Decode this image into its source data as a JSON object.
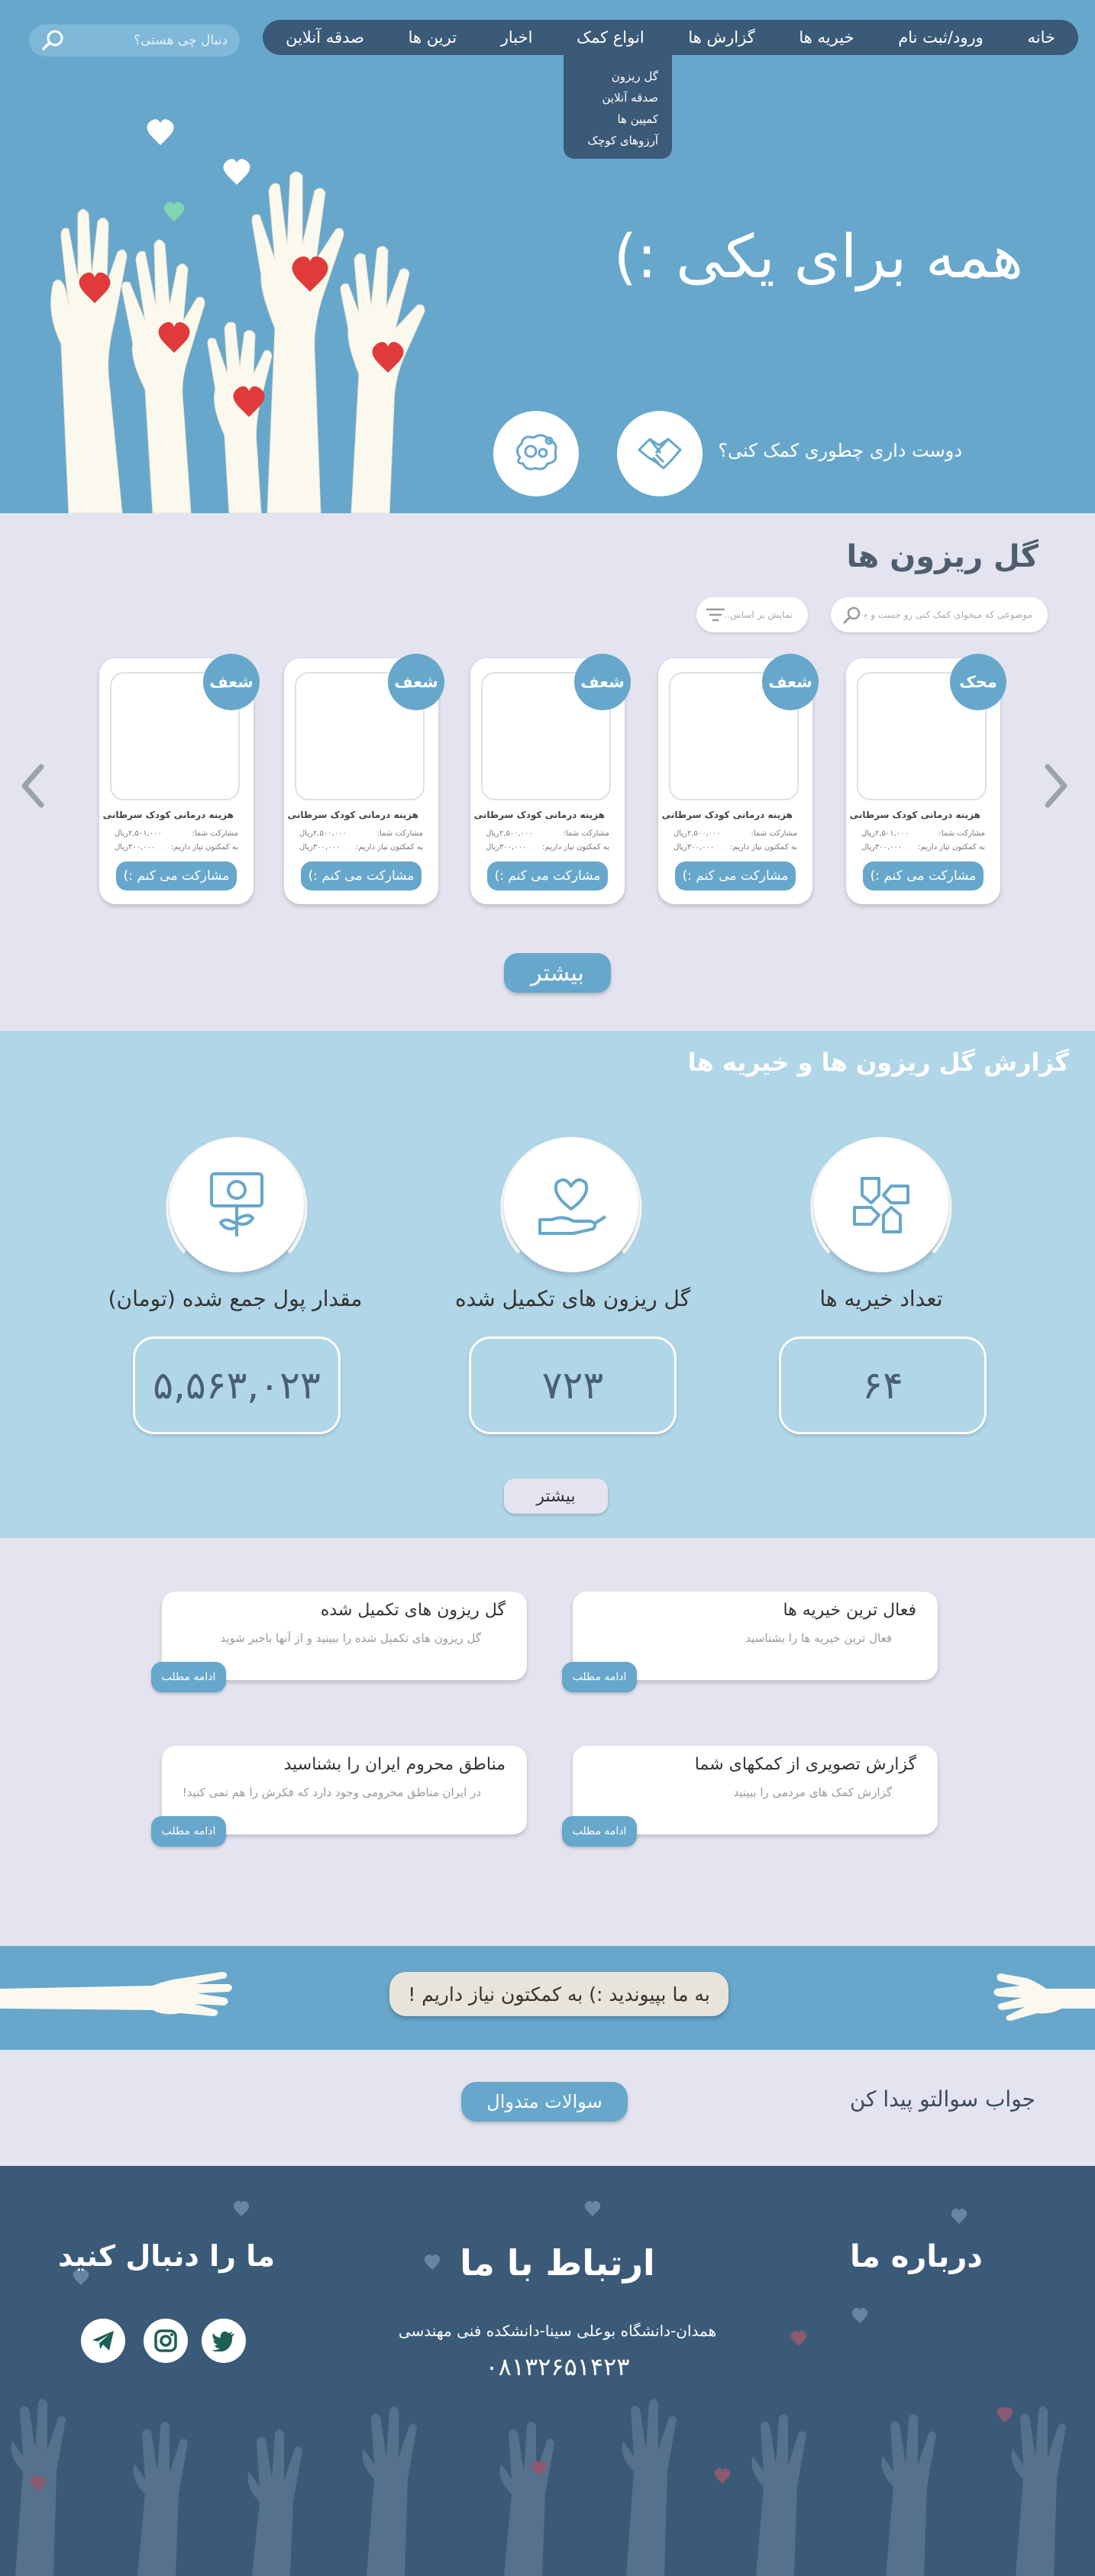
{
  "nav": {
    "items": [
      "خانه",
      "ورود/ثبت نام",
      "خیریه ها",
      "گزارش ها",
      "انواع کمک",
      "اخبار",
      "ترین ها",
      "صدقه آنلاین"
    ],
    "dropdown": [
      "گل ریزون",
      "صدقه آنلاین",
      "کمپین ها",
      "آرزوهای کوچک"
    ]
  },
  "search": {
    "placeholder": "دنبال چی هستی؟",
    "icon": "search-icon"
  },
  "hero": {
    "title": "همه برای یکی :)",
    "question": "دوست داری چطوری کمک کنی؟",
    "icons": [
      "handshake-icon",
      "brain-gear-icon"
    ]
  },
  "campaigns": {
    "title": "گل ریزون ها",
    "search_placeholder": "موضوعی که میخوای کمک کنی رو جست و جو کن.",
    "filter_placeholder": "نمایش بر اساس...",
    "cards": [
      {
        "badge": "محک",
        "name": "هزینه درمانی کودک سرطانی",
        "shared_label": "مشارکت شما:",
        "shared_value": "۲,۵۰۱,۰۰۰ریال",
        "need_label": "به کمکتون نیاز داریم:",
        "need_value": "۳۰۰,۰۰۰ریال",
        "button": "مشارکت می کنم :)"
      },
      {
        "badge": "شعف",
        "name": "هزینه درمانی کودک سرطانی",
        "shared_label": "مشارکت شما:",
        "shared_value": "۲,۵۰۰,۰۰۰ریال",
        "need_label": "به کمکتون نیاز داریم:",
        "need_value": "۳۰۰,۰۰۰ریال",
        "button": "مشارکت می کنم :)"
      },
      {
        "badge": "شعف",
        "name": "هزینه درمانی کودک سرطانی",
        "shared_label": "مشارکت شما:",
        "shared_value": "۲,۵۰۰,۰۰۰ریال",
        "need_label": "به کمکتون نیاز داریم:",
        "need_value": "۳۰۰,۰۰۰ریال",
        "button": "مشارکت می کنم :)"
      },
      {
        "badge": "شعف",
        "name": "هزینه درمانی کودک سرطانی",
        "shared_label": "مشارکت شما:",
        "shared_value": "۲,۵۰۰,۰۰۰ریال",
        "need_label": "به کمکتون نیاز داریم:",
        "need_value": "۳۰۰,۰۰۰ریال",
        "button": "مشارکت می کنم :)"
      },
      {
        "badge": "شعف",
        "name": "هزینه درمانی کودک سرطانی",
        "shared_label": "مشارکت شما:",
        "shared_value": "۲,۵۰۱,۰۰۰ریال",
        "need_label": "به کمکتون نیاز داریم:",
        "need_value": "۳۰۰,۰۰۰ریال",
        "button": "مشارکت می کنم :)"
      }
    ],
    "more": "بیشتر"
  },
  "report": {
    "title": "گزارش گل ریزون ها و خیریه ها",
    "stats": [
      {
        "label": "تعداد خیریه ها",
        "value": "۶۴",
        "icon": "hands-together-icon"
      },
      {
        "label": "گل ریزون های تکمیل شده",
        "value": "۷۲۳",
        "icon": "heart-hand-icon"
      },
      {
        "label": "مقدار پول جمع شده (تومان)",
        "value": "۵,۵۶۳,۰۲۳",
        "icon": "money-plant-icon"
      }
    ],
    "more": "بیشتر"
  },
  "info_cards": [
    {
      "title": "فعال ترین خیریه ها",
      "desc": "فعال ترین خیریه ها را بشناسید",
      "button": "ادامه مطلب"
    },
    {
      "title": "گل ریزون های تکمیل شده",
      "desc": "گل ریزون های تکمیل شده را ببینید و از آنها باخبر شوید",
      "button": "ادامه مطلب"
    },
    {
      "title": "گزارش تصویری از کمکهای شما",
      "desc": "گزارش کمک های مردمی را ببینید",
      "button": "ادامه مطلب"
    },
    {
      "title": "مناطق محروم ایران را بشناسید",
      "desc": "در ایران مناطق محرومی وجود دارد که فکرش را هم نمی کنید!",
      "button": "ادامه مطلب"
    }
  ],
  "join": {
    "text": "به ما بپیوندید :) به کمکتون نیاز داریم !"
  },
  "faq": {
    "text": "جواب سوالتو پیدا کن",
    "button": "سوالات متدوال"
  },
  "footer": {
    "about_title": "درباره ما",
    "contact_title": "ارتباط با ما",
    "address": "همدان-دانشگاه بوعلی سینا-دانشکده فنی مهندسی",
    "phone": "۰۸۱۳۲۶۵۱۴۲۳",
    "follow_title": "ما را دنبال کنید",
    "socials": [
      "twitter-icon",
      "instagram-icon",
      "telegram-icon"
    ]
  },
  "colors": {
    "primary": "#67a7cb",
    "dark": "#3b5a78",
    "light_bg": "#e4e4f1",
    "report_bg": "#b1d6e8",
    "heart": "#e03a3a"
  }
}
